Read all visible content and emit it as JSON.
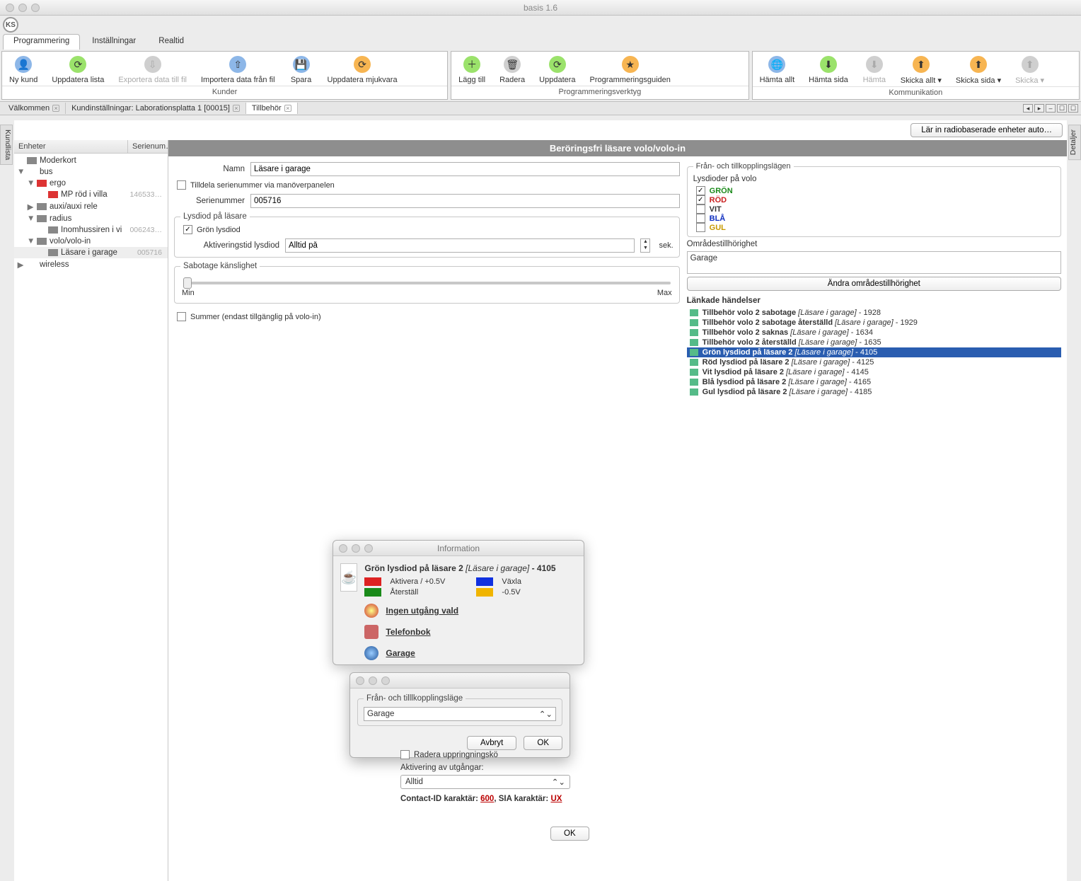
{
  "window": {
    "title": "basis 1.6"
  },
  "logo": "KS",
  "menubar": {
    "tabs": [
      "Programmering",
      "Inställningar",
      "Realtid"
    ],
    "active": 0
  },
  "toolbar": {
    "groups": [
      {
        "label": "Kunder",
        "items": [
          {
            "label": "Ny kund",
            "sub": ""
          },
          {
            "label": "Uppdatera lista",
            "sub": ""
          },
          {
            "label": "Exportera data till fil",
            "sub": "",
            "disabled": true
          },
          {
            "label": "Importera data från fil",
            "sub": ""
          },
          {
            "label": "Spara",
            "sub": ""
          },
          {
            "label": "Uppdatera mjukvara",
            "sub": ""
          }
        ]
      },
      {
        "label": "Programmeringsverktyg",
        "items": [
          {
            "label": "Lägg till"
          },
          {
            "label": "Radera"
          },
          {
            "label": "Uppdatera"
          },
          {
            "label": "Programmeringsguiden"
          }
        ]
      },
      {
        "label": "Kommunikation",
        "items": [
          {
            "label": "Hämta allt"
          },
          {
            "label": "Hämta sida"
          },
          {
            "label": "Hämta",
            "disabled": true
          },
          {
            "label": "Skicka allt ▾"
          },
          {
            "label": "Skicka sida ▾"
          },
          {
            "label": "Skicka ▾",
            "disabled": true
          }
        ]
      }
    ]
  },
  "doc_tabs": {
    "items": [
      {
        "label": "Välkommen"
      },
      {
        "label": "Kundinställningar: Laborationsplatta 1 [00015]"
      },
      {
        "label": "Tillbehör",
        "active": true
      }
    ]
  },
  "side_tabs": {
    "left": "Kundlista",
    "right": "Detaljer"
  },
  "top_button": "Lär in radiobaserade enheter auto…",
  "tree": {
    "headers": [
      "Enheter",
      "Serienum…"
    ],
    "rows": [
      {
        "ind": 0,
        "tw": "",
        "icon": "gray",
        "label": "Moderkort"
      },
      {
        "ind": 0,
        "tw": "▼",
        "icon": "blue",
        "label": "bus"
      },
      {
        "ind": 1,
        "tw": "▼",
        "icon": "red",
        "label": "ergo"
      },
      {
        "ind": 2,
        "tw": "",
        "icon": "red",
        "label": "MP röd i villa",
        "serial": "146533…"
      },
      {
        "ind": 1,
        "tw": "▶",
        "icon": "gray",
        "label": "auxi/auxi rele"
      },
      {
        "ind": 1,
        "tw": "▼",
        "icon": "gray",
        "label": "radius"
      },
      {
        "ind": 2,
        "tw": "",
        "icon": "gray",
        "label": "Inomhussiren i vi",
        "serial": "006243…"
      },
      {
        "ind": 1,
        "tw": "▼",
        "icon": "gray",
        "label": "volo/volo-in"
      },
      {
        "ind": 2,
        "tw": "",
        "icon": "gray",
        "label": "Läsare i garage",
        "serial": "005716",
        "selected": true
      },
      {
        "ind": 0,
        "tw": "▶",
        "icon": "blue",
        "label": "wireless"
      }
    ]
  },
  "form": {
    "header": "Beröringsfri läsare volo/volo-in",
    "name_label": "Namn",
    "name_value": "Läsare i garage",
    "assign_serial": "Tilldela serienummer via manöverpanelen",
    "serial_label": "Serienummer",
    "serial_value": "005716",
    "led_group": "Lysdiod på läsare",
    "green_led": "Grön lysdiod",
    "act_time_label": "Aktiveringstid lysdiod",
    "act_time_value": "Alltid på",
    "sek": "sek.",
    "sab_group": "Sabotage känslighet",
    "min": "Min",
    "max": "Max",
    "buzzer": "Summer (endast tillgänglig på volo-in)"
  },
  "right_panel": {
    "group": "Från- och tillkopplingslägen",
    "led_title": "Lysdioder på volo",
    "colors": [
      {
        "label": "GRÖN",
        "cls": "cc-green",
        "checked": true
      },
      {
        "label": "RÖD",
        "cls": "cc-red",
        "checked": true
      },
      {
        "label": "VIT",
        "cls": "cc-white",
        "checked": false
      },
      {
        "label": "BLÅ",
        "cls": "cc-blue",
        "checked": false
      },
      {
        "label": "GUL",
        "cls": "cc-yellow",
        "checked": false
      }
    ],
    "area_title": "Områdestillhörighet",
    "area_value": "Garage",
    "change_btn": "Ändra områdestillhörighet",
    "linked_title": "Länkade händelser",
    "linked": [
      {
        "t": "Tillbehör volo 2 sabotage",
        "d": "[Läsare i garage]",
        "n": "1928"
      },
      {
        "t": "Tillbehör volo 2 sabotage återställd",
        "d": "[Läsare i garage]",
        "n": "1929"
      },
      {
        "t": "Tillbehör volo 2 saknas",
        "d": "[Läsare i garage]",
        "n": "1634"
      },
      {
        "t": "Tillbehör volo 2 återställd",
        "d": "[Läsare i garage]",
        "n": "1635"
      },
      {
        "t": "Grön lysdiod på läsare 2",
        "d": "[Läsare i garage]",
        "n": "4105",
        "selected": true
      },
      {
        "t": "Röd lysdiod på läsare 2",
        "d": "[Läsare i garage]",
        "n": "4125"
      },
      {
        "t": "Vit lysdiod på läsare 2",
        "d": "[Läsare i garage]",
        "n": "4145"
      },
      {
        "t": "Blå lysdiod på läsare 2",
        "d": "[Läsare i garage]",
        "n": "4165"
      },
      {
        "t": "Gul lysdiod på läsare 2",
        "d": "[Läsare i garage]",
        "n": "4185"
      }
    ]
  },
  "info_dialog": {
    "title": "Information",
    "heading": "Grön lysdiod på läsare 2",
    "heading_detail": "[Läsare i garage]",
    "heading_num": "4105",
    "swatches": [
      {
        "cls": "sw-red",
        "label": "Aktivera / +0.5V"
      },
      {
        "cls": "sw-blue",
        "label": "Växla"
      },
      {
        "cls": "sw-green",
        "label": "Återställ"
      },
      {
        "cls": "sw-yellow",
        "label": "-0.5V"
      }
    ],
    "links": [
      {
        "icon": "db-red",
        "label": "Ingen utgång vald"
      },
      {
        "icon": "db-book",
        "label": "Telefonbok"
      },
      {
        "icon": "db-globe",
        "label": "Garage"
      }
    ]
  },
  "mini_dialog": {
    "group": "Från- och tilllkopplingsläge",
    "value": "Garage",
    "cancel": "Avbryt",
    "ok": "OK"
  },
  "under": {
    "radera": "Radera uppringningskö",
    "act_label": "Aktivering av utgångar:",
    "act_value": "Alltid",
    "contact_prefix": "Contact-ID karaktär: ",
    "contact_val": "600",
    "sia_prefix": ", SIA karaktär: ",
    "sia_val": "UX",
    "ok": "OK"
  }
}
